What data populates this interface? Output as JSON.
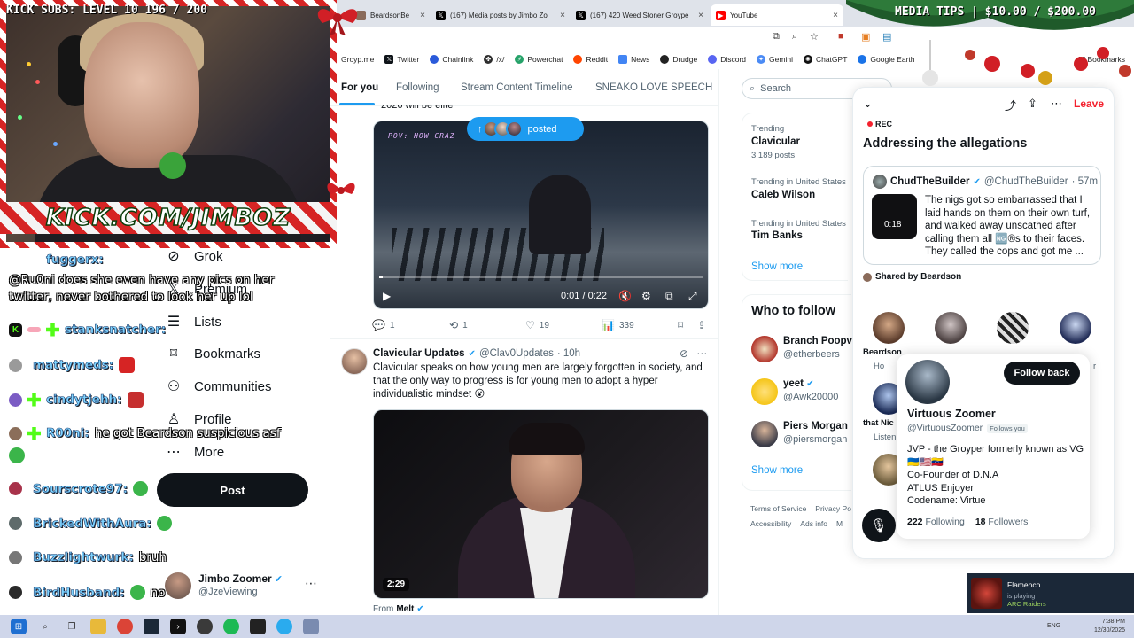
{
  "overlay": {
    "kick_subs": "KICK SUBS: LEVEL 10 196 / 200",
    "kick_url": "KICK.COM/JIMBOZ",
    "media_tips": "MEDIA TIPS | $10.00 / $200.00"
  },
  "browser": {
    "tabs": [
      {
        "label": "BeardsonBe",
        "icon": "beardson-favicon"
      },
      {
        "label": "(167) Media posts by Jimbo Zo",
        "icon": "x-logo-icon"
      },
      {
        "label": "(167) 420 Weed Stoner Groype",
        "icon": "x-logo-icon"
      },
      {
        "label": "YouTube",
        "icon": "youtube-icon"
      }
    ],
    "bookmarks": [
      {
        "label": "Groyp.me",
        "color": "#9aa0a6"
      },
      {
        "label": "Twitter",
        "color": "#0f1419"
      },
      {
        "label": "Chainlink",
        "color": "#2a5ada"
      },
      {
        "label": "/x/",
        "color": "#2d2d2d"
      },
      {
        "label": "Powerchat",
        "color": "#26a269"
      },
      {
        "label": "Reddit",
        "color": "#ff4500"
      },
      {
        "label": "News",
        "color": "#4285f4"
      },
      {
        "label": "Drudge",
        "color": "#222"
      },
      {
        "label": "Discord",
        "color": "#5865f2"
      },
      {
        "label": "Gemini",
        "color": "#4b8bf5"
      },
      {
        "label": "ChatGPT",
        "color": "#111"
      },
      {
        "label": "Google Earth",
        "color": "#1a73e8"
      }
    ],
    "all_bookmarks": "All Bookmarks"
  },
  "chat": {
    "fuggerx": "fuggerx:",
    "ruoni_msg": "@Ru0ni does she even have any pics on her twitter, never bothered to look her up lol",
    "lines": [
      {
        "user": "stanksnatcher:",
        "msg": ""
      },
      {
        "user": "mattymeds:",
        "msg": ""
      },
      {
        "user": "cindytjehh:",
        "msg": ""
      },
      {
        "user": "R00ni:",
        "msg": "he got Beardson suspicious asf"
      },
      {
        "user": "Sourscrote97:",
        "msg": ""
      },
      {
        "user": "BrickedWithAura:",
        "msg": ""
      },
      {
        "user": "Buzzlightwurk:",
        "msg": "bruh"
      },
      {
        "user": "BirdHusband:",
        "msg": "no"
      }
    ]
  },
  "nav": {
    "items": [
      {
        "label": "Grok",
        "icon": "grok-icon",
        "glyph": "⊘"
      },
      {
        "label": "Premium",
        "icon": "x-premium-icon",
        "glyph": "𝕏"
      },
      {
        "label": "Lists",
        "icon": "lists-icon",
        "glyph": "☰"
      },
      {
        "label": "Bookmarks",
        "icon": "bookmark-icon",
        "glyph": "🔖"
      },
      {
        "label": "Communities",
        "icon": "communities-icon",
        "glyph": "👥"
      },
      {
        "label": "Profile",
        "icon": "profile-icon",
        "glyph": "👤"
      },
      {
        "label": "More",
        "icon": "more-circle-icon",
        "glyph": "⋯"
      }
    ],
    "post": "Post",
    "account": {
      "name": "Jimbo Zoomer",
      "handle": "@JzeViewing"
    }
  },
  "timeline": {
    "tabs": [
      "For you",
      "Following",
      "Stream Content Timeline",
      "SNEAKO LOVE SPEECH"
    ],
    "prev_text": "2026 will be elite",
    "posted_pill": "posted",
    "tweet0": {
      "pov_text": "POV: HOW CRAZ",
      "time": "0:01 / 0:22",
      "replies": "1",
      "reposts": "1",
      "likes": "19",
      "views": "339"
    },
    "tweet1": {
      "name": "Clavicular Updates",
      "handle": "@Clav0Updates",
      "age": "· 10h",
      "body": "Clavicular speaks on how young men are largely forgotten in society, and that the only way to progress is for young men to adopt a hyper individualistic mindset 😮",
      "duration": "2:29",
      "from_label": "From",
      "from_name": "Melt"
    }
  },
  "right": {
    "search_placeholder": "Search",
    "trending": [
      {
        "context": "Trending",
        "name": "Clavicular",
        "count": "3,189 posts"
      },
      {
        "context": "Trending in United States",
        "name": "Caleb Wilson",
        "count": ""
      },
      {
        "context": "Trending in United States",
        "name": "Tim Banks",
        "count": ""
      }
    ],
    "show_more": "Show more",
    "who_to_follow": "Who to follow",
    "follow": [
      {
        "name": "Branch Poopvic",
        "handle": "@etherbeers",
        "color": "#b2342a"
      },
      {
        "name": "yeet",
        "handle": "@Awk20000",
        "color": "#f5c518"
      },
      {
        "name": "Piers Morgan",
        "handle": "@piersmorgan",
        "color": "#3b3c48"
      }
    ],
    "footer": [
      "Terms of Service",
      "Privacy Po",
      "Accessibility",
      "Ads info",
      "M"
    ]
  },
  "space": {
    "leave": "Leave",
    "rec": "REC",
    "title": "Addressing the allegations",
    "quote": {
      "name": "ChudTheBuilder",
      "handle": "@ChudTheBuilder",
      "age": "· 57m",
      "duration": "0:18",
      "body": "The nigs got so embarrassed that I laid hands on them on their own turf, and walked away unscathed after calling them all 🆖®s to their faces. They called the cops and got me ..."
    },
    "shared_by": "Shared by Beardson",
    "speakers": [
      {
        "name": "Beardson",
        "sub": "Ho"
      },
      {
        "name": "",
        "sub": ""
      },
      {
        "name": "",
        "sub": ""
      },
      {
        "name": "",
        "sub": "r"
      }
    ],
    "listener_name": "that Nic",
    "listener_sub": "Listen"
  },
  "hovercard": {
    "follow_back": "Follow back",
    "name": "Virtuous Zoomer",
    "handle": "@VirtuousZoomer",
    "follows_you": "Follows you",
    "bio_lines": [
      "JVP - the Groyper formerly known as VG 🇺🇦🇺🇸🇻🇪",
      "Co-Founder of D.N.A",
      "ATLUS Enjoyer",
      "Codename: Virtue"
    ],
    "following_count": "222",
    "following_label": "Following",
    "followers_count": "18",
    "followers_label": "Followers"
  },
  "steam": {
    "game": "Flamenco",
    "status": "is playing",
    "title": "ARC Raiders"
  },
  "tray": {
    "lang": "ENG",
    "time": "7:38 PM",
    "date": "12/30/2025"
  },
  "colors": {
    "x_blue": "#1d9bf0",
    "leave_red": "#f4212e",
    "black": "#0f1419"
  }
}
